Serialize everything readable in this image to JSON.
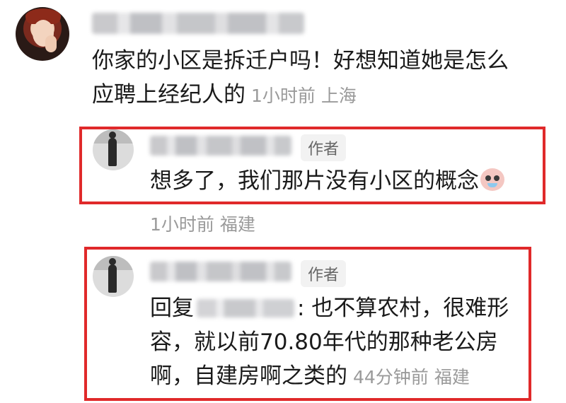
{
  "comment": {
    "text_line1": "你家的小区是拆迁户吗！好想知道她是怎么",
    "text_line2": "应聘上经纪人的",
    "time": "1小时前",
    "location": "上海"
  },
  "reply1": {
    "author_tag": "作者",
    "text": "想多了，我们那片没有小区的概念",
    "time": "1小时前",
    "location": "福建"
  },
  "reply2": {
    "author_tag": "作者",
    "prefix": "回复",
    "line1_suffix": ": 也不算农村，很难形",
    "line2": "容，就以前70.80年代的那种老公房",
    "line3": "啊，自建房啊之类的",
    "time": "44分钟前",
    "location": "福建"
  },
  "colors": {
    "highlight_box": "#e0292a",
    "meta_text": "#9a9a9a",
    "body_text": "#1a1a1a"
  }
}
